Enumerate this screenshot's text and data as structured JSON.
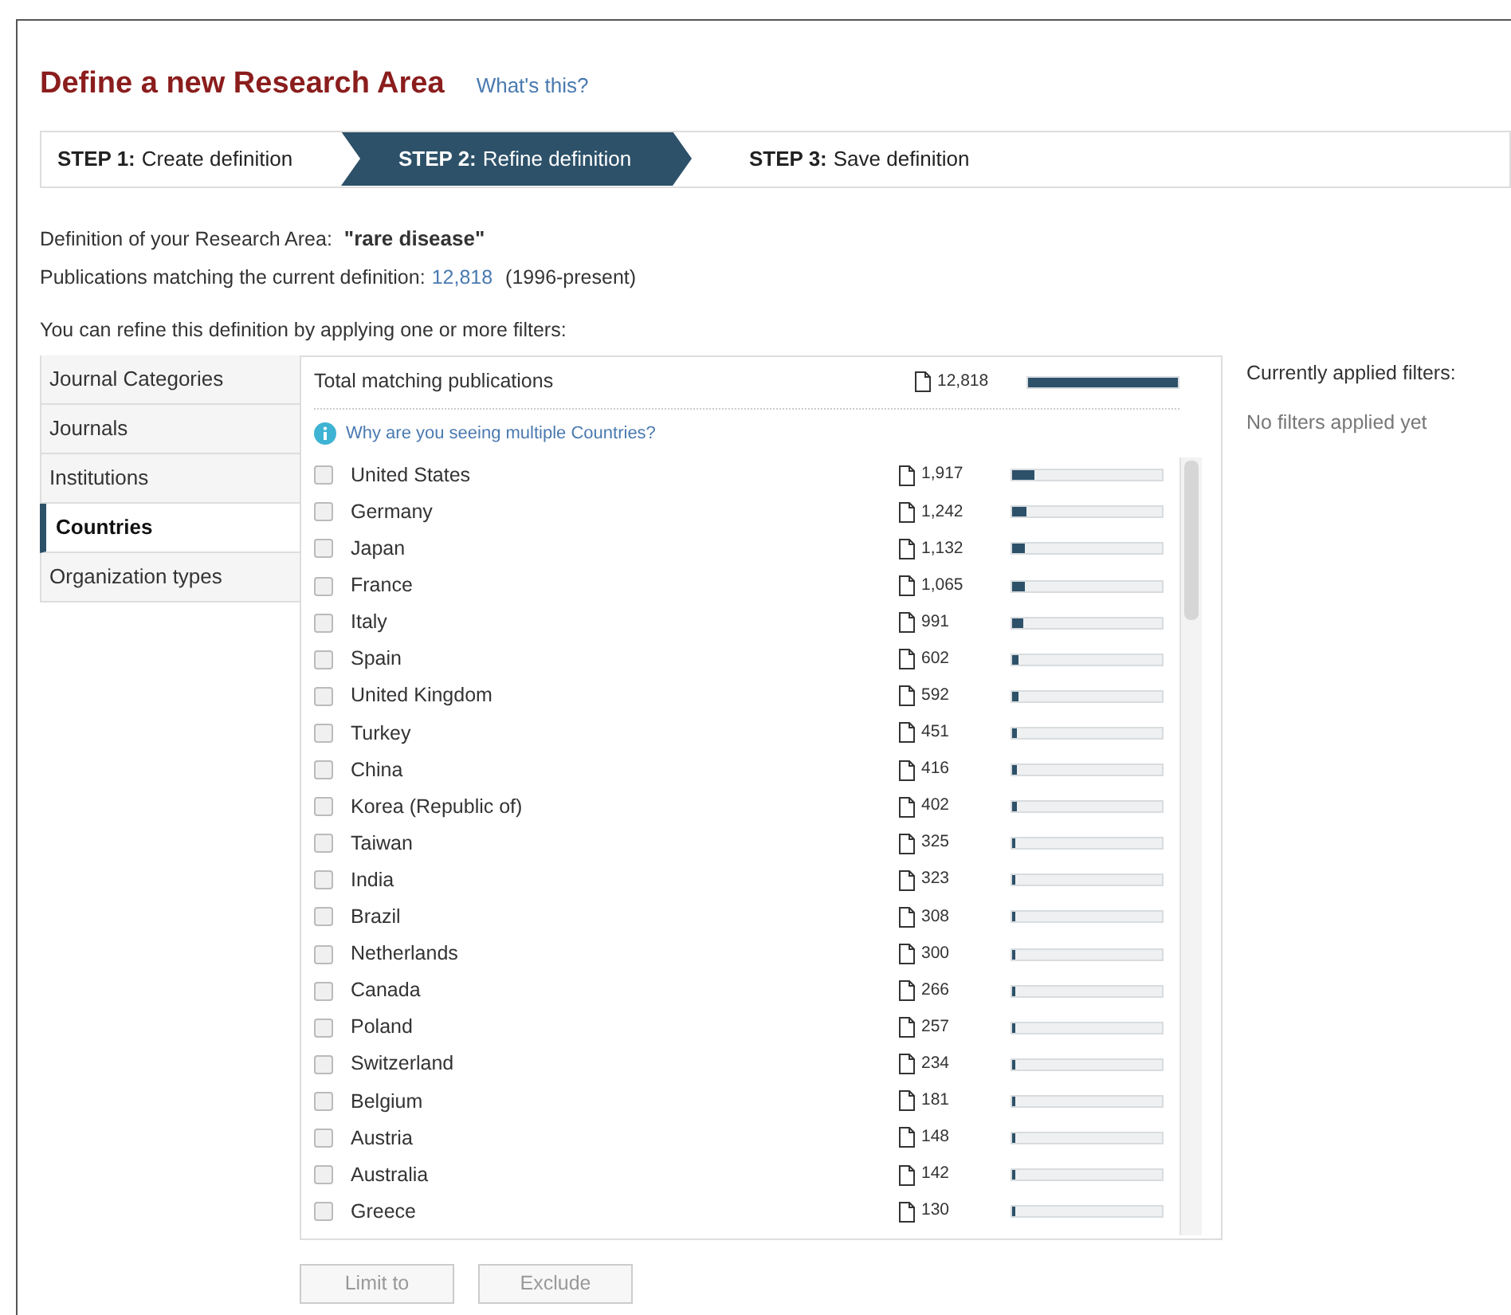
{
  "title": "Define a new Research Area",
  "help_link": "What's this?",
  "steps": [
    {
      "label": "STEP 1:",
      "text": "Create definition",
      "selected": false
    },
    {
      "label": "STEP 2:",
      "text": "Refine definition",
      "selected": true
    },
    {
      "label": "STEP 3:",
      "text": "Save definition",
      "selected": false
    }
  ],
  "definition": {
    "label": "Definition of your Research Area:",
    "value": "\"rare  disease\""
  },
  "matching": {
    "label": "Publications matching the current definition:",
    "count": "12,818",
    "range": "(1996-present)"
  },
  "refine_hint": "You can refine this definition by applying one or more filters:",
  "filter_tabs": [
    {
      "label": "Journal Categories",
      "selected": false
    },
    {
      "label": "Journals",
      "selected": false
    },
    {
      "label": "Institutions",
      "selected": false
    },
    {
      "label": "Countries",
      "selected": true
    },
    {
      "label": "Organization types",
      "selected": false
    }
  ],
  "total": {
    "label": "Total matching publications",
    "count": "12,818",
    "level": 1
  },
  "info_link": "Why are you seeing multiple Countries?",
  "rows": [
    {
      "name": "United States",
      "count": "1,917",
      "level": 0.15,
      "checked": false
    },
    {
      "name": "Germany",
      "count": "1,242",
      "level": 0.097,
      "checked": false
    },
    {
      "name": "Japan",
      "count": "1,132",
      "level": 0.088,
      "checked": false
    },
    {
      "name": "France",
      "count": "1,065",
      "level": 0.083,
      "checked": false
    },
    {
      "name": "Italy",
      "count": "991",
      "level": 0.077,
      "checked": false
    },
    {
      "name": "Spain",
      "count": "602",
      "level": 0.047,
      "checked": false
    },
    {
      "name": "United Kingdom",
      "count": "592",
      "level": 0.046,
      "checked": false
    },
    {
      "name": "Turkey",
      "count": "451",
      "level": 0.035,
      "checked": false
    },
    {
      "name": "China",
      "count": "416",
      "level": 0.032,
      "checked": false
    },
    {
      "name": "Korea (Republic of)",
      "count": "402",
      "level": 0.031,
      "checked": false
    },
    {
      "name": "Taiwan",
      "count": "325",
      "level": 0.025,
      "checked": false
    },
    {
      "name": "India",
      "count": "323",
      "level": 0.025,
      "checked": false
    },
    {
      "name": "Brazil",
      "count": "308",
      "level": 0.024,
      "checked": false
    },
    {
      "name": "Netherlands",
      "count": "300",
      "level": 0.023,
      "checked": false
    },
    {
      "name": "Canada",
      "count": "266",
      "level": 0.021,
      "checked": false
    },
    {
      "name": "Poland",
      "count": "257",
      "level": 0.02,
      "checked": false
    },
    {
      "name": "Switzerland",
      "count": "234",
      "level": 0.018,
      "checked": false
    },
    {
      "name": "Belgium",
      "count": "181",
      "level": 0.014,
      "checked": false
    },
    {
      "name": "Austria",
      "count": "148",
      "level": 0.012,
      "checked": false
    },
    {
      "name": "Australia",
      "count": "142",
      "level": 0.011,
      "checked": false
    },
    {
      "name": "Greece",
      "count": "130",
      "level": 0.01,
      "checked": false
    }
  ],
  "actions": [
    {
      "label": "Limit to",
      "disabled": true
    },
    {
      "label": "Exclude",
      "disabled": true
    }
  ],
  "applied": {
    "title": "Currently applied filters:",
    "empty": "No filters applied yet"
  }
}
